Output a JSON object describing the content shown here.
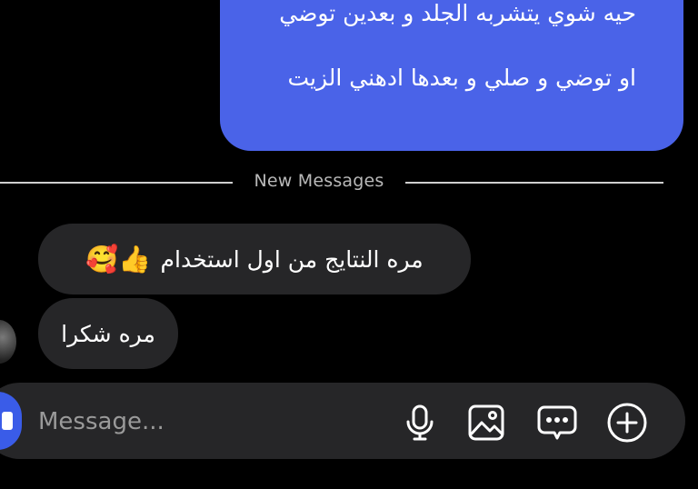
{
  "thread": {
    "sent_message": {
      "line1": "حيه شوي يتشربه الجلد و بعدين توضي",
      "line2": "او توضي و صلي و بعدها ادهني الزيت"
    },
    "divider_label": "New Messages",
    "received_messages": [
      {
        "text": "مره النتايج من اول استخدام",
        "emojis": "👍🥰"
      },
      {
        "text": "مره شكرا"
      }
    ]
  },
  "composer": {
    "placeholder": "Message..."
  },
  "colors": {
    "sent_bubble": "#4a63e8",
    "received_bubble": "#262628",
    "background": "#000000",
    "camera_button": "#3a5ce8"
  },
  "icons": [
    "camera-icon",
    "microphone-icon",
    "gallery-icon",
    "sticker-icon",
    "plus-icon"
  ]
}
